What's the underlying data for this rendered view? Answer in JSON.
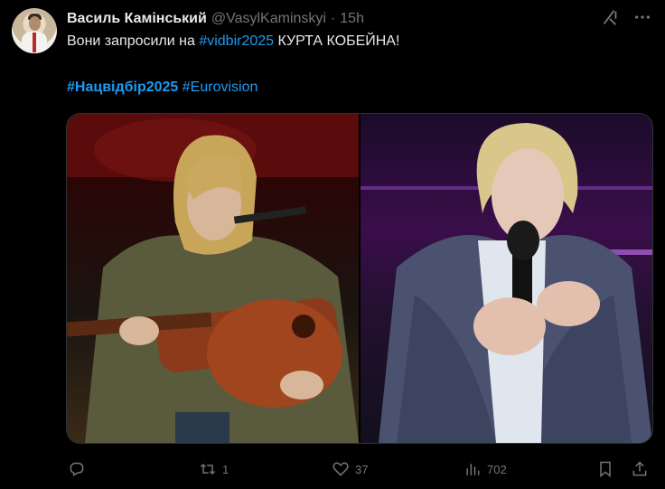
{
  "author": {
    "name": "Василь Камінський",
    "handle": "@VasylKaminskyi",
    "separator": "·",
    "time": "15h"
  },
  "tweet": {
    "text_before": "Вони запросили на ",
    "hashtag_inline": "#vidbir2025",
    "text_after": " КУРТА КОБЕЙНА!",
    "hashtags": [
      "#Нацвідбір2025",
      "#Eurovision"
    ]
  },
  "actions": {
    "reply_count": "",
    "retweet_count": "1",
    "like_count": "37",
    "views_count": "702"
  },
  "icons": {
    "grok": "grok-icon",
    "more": "more-icon",
    "reply": "reply-icon",
    "retweet": "retweet-icon",
    "like": "like-icon",
    "views": "views-icon",
    "bookmark": "bookmark-icon",
    "share": "share-icon"
  },
  "colors": {
    "background": "#000000",
    "text": "#e7e9ea",
    "muted": "#71767b",
    "accent": "#1d9bf0"
  }
}
